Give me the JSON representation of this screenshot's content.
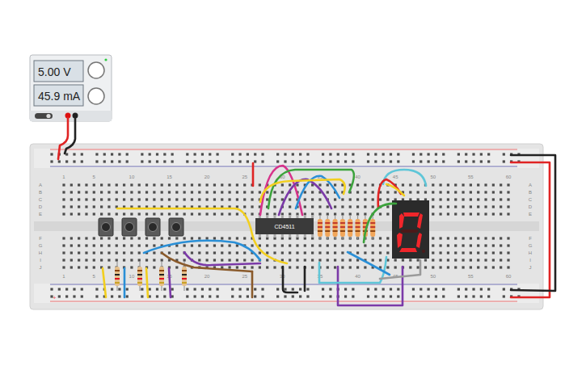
{
  "power_supply": {
    "voltage": "5.00 V",
    "current": "45.9 mA",
    "on": true
  },
  "breadboard": {
    "columns": [
      "1",
      "5",
      "10",
      "15",
      "20",
      "25",
      "30",
      "35",
      "40",
      "45",
      "50",
      "55",
      "60"
    ],
    "rows_top": [
      "A",
      "B",
      "C",
      "D",
      "E"
    ],
    "rows_bottom": [
      "F",
      "G",
      "H",
      "I",
      "J"
    ]
  },
  "chip": {
    "label": "CD4511"
  },
  "display": {
    "segments": [
      {
        "name": "a",
        "on": true
      },
      {
        "name": "b",
        "on": true
      },
      {
        "name": "c",
        "on": true
      },
      {
        "name": "d",
        "on": true
      },
      {
        "name": "e",
        "on": true
      },
      {
        "name": "f",
        "on": true
      },
      {
        "name": "g",
        "on": false
      }
    ]
  }
}
